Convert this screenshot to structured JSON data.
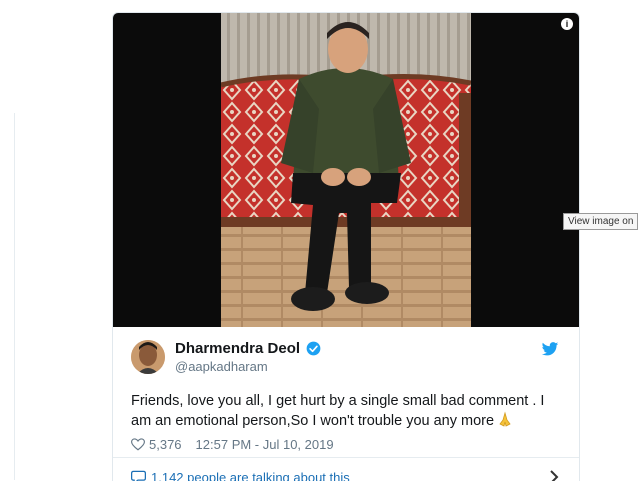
{
  "tweet": {
    "display_name": "Dharmendra Deol",
    "handle": "@aapkadharam",
    "verified": true,
    "text": "Friends, love you all, I get hurt by a single small bad comment . I am an emotional person,So I won't trouble you any more",
    "emoji": "folded-hands-emoji",
    "likes": "5,376",
    "timestamp": "12:57 PM - Jul 10, 2019",
    "talking_about": "1,142 people are talking about this"
  },
  "media": {
    "tooltip": "View image on"
  },
  "icons": {
    "info": "info-icon",
    "verified": "verified-badge-icon",
    "bird": "twitter-bird-icon",
    "heart": "heart-icon",
    "bubble": "speech-bubble-icon",
    "chevron": "chevron-right-icon"
  },
  "colors": {
    "twitter_blue": "#1da1f2",
    "link_blue": "#1b6fb5",
    "secondary_text": "#657786"
  }
}
